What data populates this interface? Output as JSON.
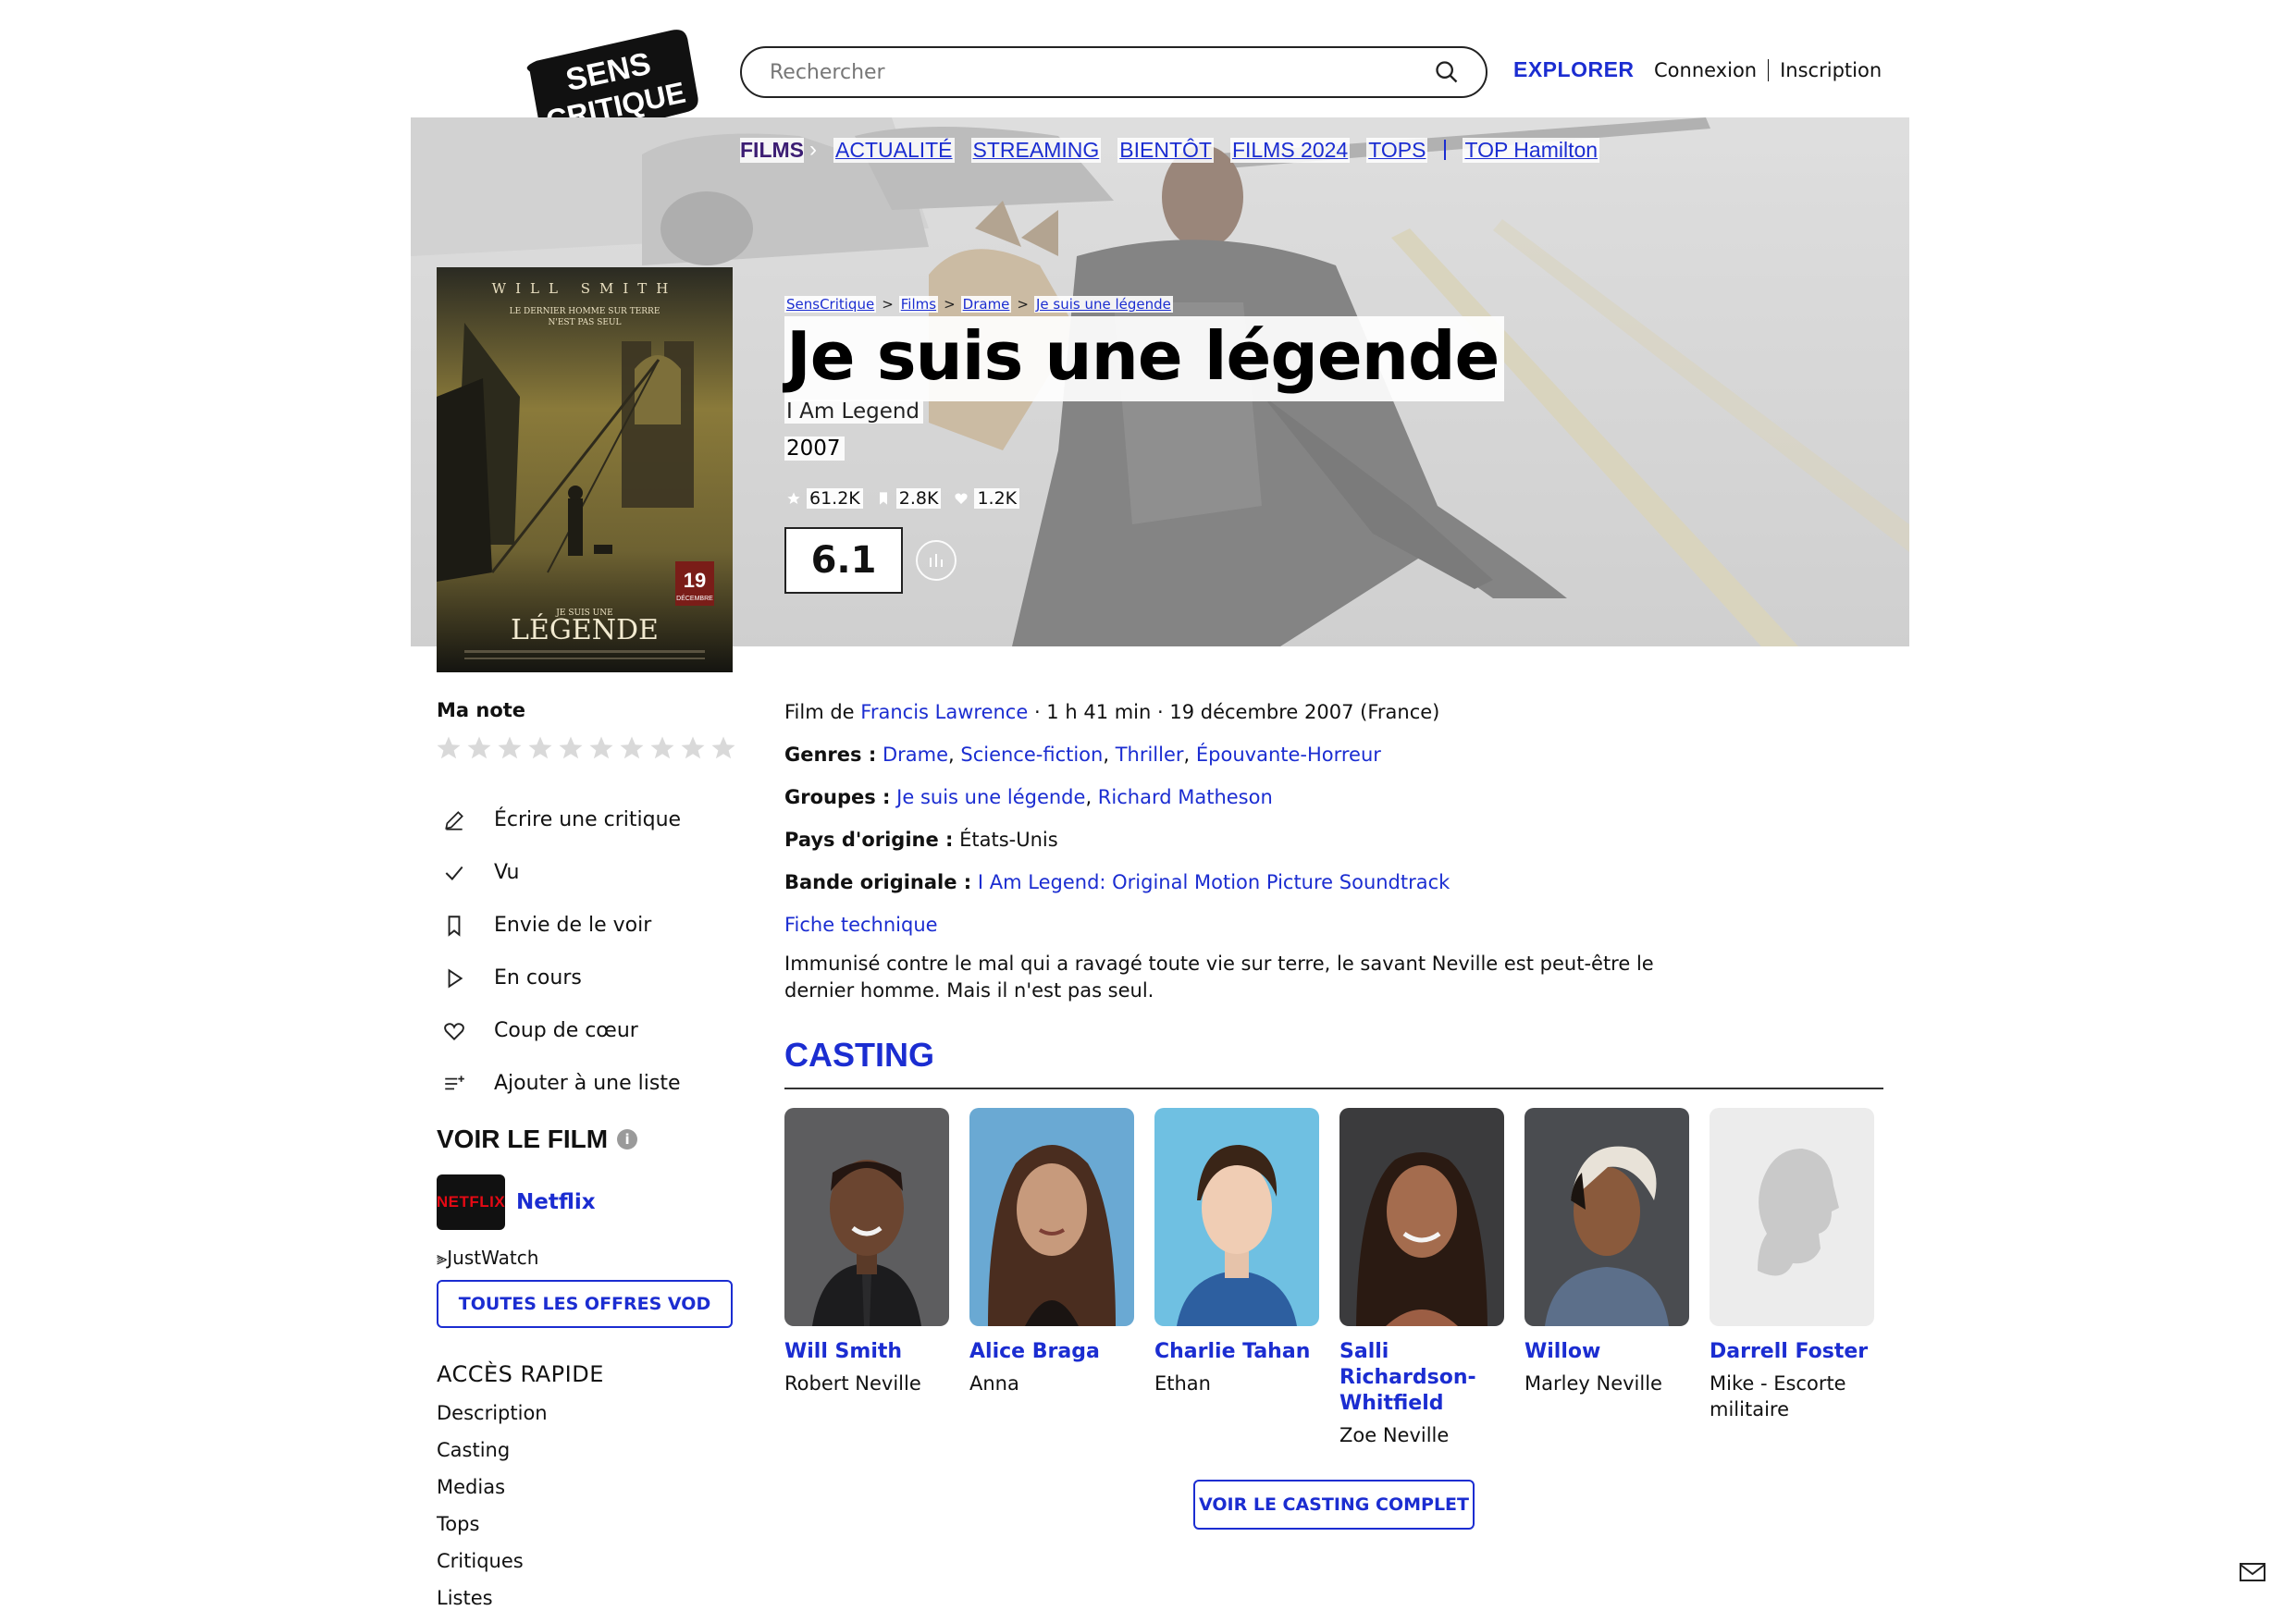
{
  "logo": {
    "line1": "SENS",
    "line2": "CRITIQUE"
  },
  "search": {
    "placeholder": "Rechercher"
  },
  "header": {
    "explorer": "EXPLORER",
    "login": "Connexion",
    "signup": "Inscription"
  },
  "nav": {
    "films": "FILMS",
    "chevron": "›",
    "items": [
      "ACTUALITÉ",
      "STREAMING",
      "BIENTÔT",
      "FILMS 2024",
      "TOPS"
    ],
    "top": "TOP Hamilton"
  },
  "breadcrumb": {
    "items": [
      "SensCritique",
      "Films",
      "Drame",
      "Je suis une légende"
    ],
    "separator": ">"
  },
  "poster": {
    "actor": "WILL SMITH",
    "tagline1": "LE DERNIER HOMME SUR TERRE",
    "tagline2": "N'EST PAS SEUL",
    "small_title": "JE SUIS UNE",
    "big_title": "LÉGENDE",
    "date_day": "19",
    "date_month": "DÉCEMBRE"
  },
  "movie": {
    "title": "Je suis une légende",
    "original_title": "I Am Legend",
    "year": "2007",
    "stats": {
      "ratings": "61.2K",
      "wishlist": "2.8K",
      "favorites": "1.2K"
    },
    "score": "6.1"
  },
  "sidebar": {
    "my_rating_label": "Ma note",
    "rating_max": 10,
    "actions": [
      "Écrire une critique",
      "Vu",
      "Envie de le voir",
      "En cours",
      "Coup de cœur",
      "Ajouter à une liste"
    ],
    "watch_title": "VOIR LE FILM",
    "info_glyph": "i",
    "provider_logo": "NETFLIX",
    "provider": "Netflix",
    "justwatch": "JustWatch",
    "vod_button": "TOUTES LES OFFRES VOD",
    "quick_title": "ACCÈS RAPIDE",
    "quick_links": [
      "Description",
      "Casting",
      "Medias",
      "Tops",
      "Critiques",
      "Listes"
    ]
  },
  "details": {
    "film_by_prefix": "Film de",
    "director": "Francis Lawrence",
    "meta": " · 1 h 41 min · 19 décembre 2007 (France)",
    "genres_label": "Genres :",
    "genres": [
      "Drame",
      "Science-fiction",
      "Thriller",
      "Épouvante-Horreur"
    ],
    "groups_label": "Groupes :",
    "groups": [
      "Je suis une légende",
      "Richard Matheson"
    ],
    "country_label": "Pays d'origine :",
    "country": "États-Unis",
    "soundtrack_label": "Bande originale :",
    "soundtrack": "I Am Legend: Original Motion Picture Soundtrack",
    "tech_sheet": "Fiche technique",
    "synopsis": "Immunisé contre le mal qui a ravagé toute vie sur terre, le savant Neville est peut-être le dernier homme. Mais il n'est pas seul."
  },
  "casting": {
    "title": "CASTING",
    "actors": [
      {
        "name": "Will Smith",
        "role": "Robert Neville"
      },
      {
        "name": "Alice Braga",
        "role": "Anna"
      },
      {
        "name": "Charlie Tahan",
        "role": "Ethan"
      },
      {
        "name": "Salli Richardson-Whitfield",
        "role": "Zoe Neville"
      },
      {
        "name": "Willow",
        "role": "Marley Neville"
      },
      {
        "name": "Darrell Foster",
        "role": "Mike - Escorte militaire"
      }
    ],
    "button": "VOIR LE CASTING COMPLET"
  },
  "colors": {
    "accent": "#1b2dd1",
    "films_nav": "#3c1d73",
    "netflix_red": "#e50914"
  },
  "icons": [
    "search-icon",
    "chevron-right-icon",
    "star-icon",
    "bookmark-icon",
    "heart-icon",
    "bar-chart-icon",
    "pencil-icon",
    "check-icon",
    "play-icon",
    "list-add-icon",
    "info-icon",
    "mail-icon"
  ]
}
